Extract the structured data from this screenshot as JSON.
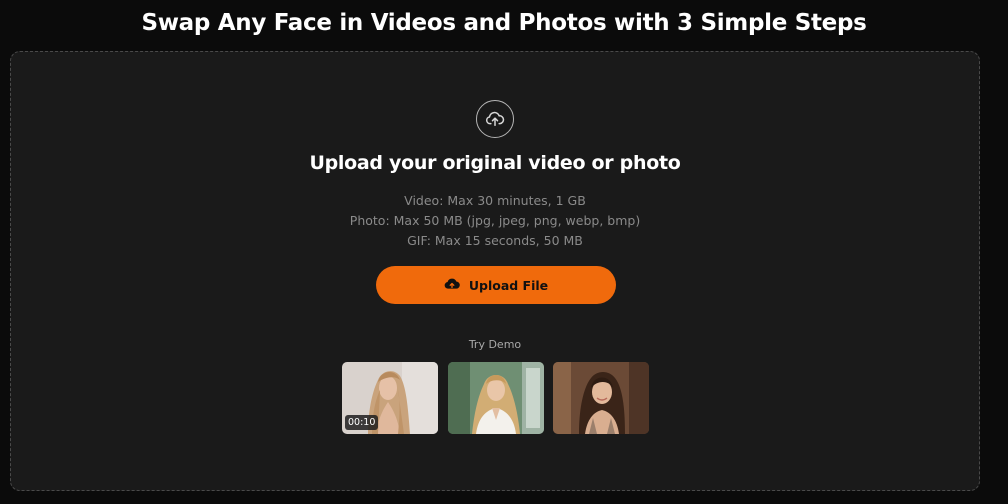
{
  "header": {
    "title": "Swap Any Face in Videos and Photos with 3 Simple Steps"
  },
  "upload": {
    "icon": "cloud-upload-icon",
    "title": "Upload your original video or photo",
    "limits": [
      "Video: Max 30 minutes, 1 GB",
      "Photo: Max 50 MB (jpg, jpeg, png, webp, bmp)",
      "GIF: Max 15 seconds, 50 MB"
    ],
    "button_label": "Upload File",
    "button_icon": "cloud-upload-icon",
    "button_color": "#f06a0c"
  },
  "demo": {
    "label": "Try Demo",
    "items": [
      {
        "type": "video",
        "duration": "00:10"
      },
      {
        "type": "photo"
      },
      {
        "type": "photo"
      }
    ]
  },
  "colors": {
    "background": "#0b0b0b",
    "panel": "#1a1a1a",
    "accent": "#f06a0c"
  }
}
